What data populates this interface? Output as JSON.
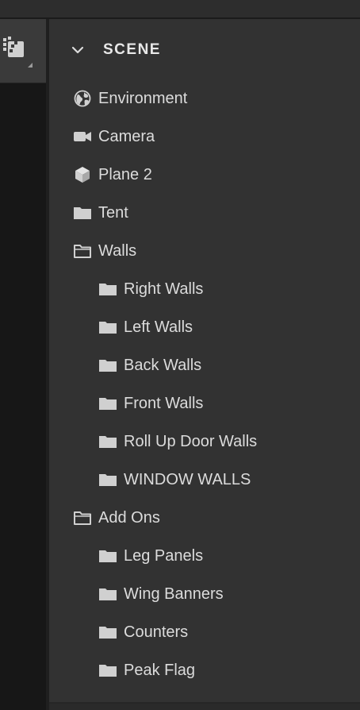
{
  "panel": {
    "header": {
      "title": "SCENE",
      "expand_icon": "chevron-down-icon"
    },
    "items": [
      {
        "label": "Environment",
        "icon": "globe-icon"
      },
      {
        "label": "Camera",
        "icon": "camera-icon"
      },
      {
        "label": "Plane 2",
        "icon": "cube-icon"
      },
      {
        "label": "Tent",
        "icon": "folder-closed-icon"
      },
      {
        "label": "Walls",
        "icon": "folder-open-icon"
      },
      {
        "label": "Right Walls",
        "icon": "folder-closed-icon"
      },
      {
        "label": "Left Walls",
        "icon": "folder-closed-icon"
      },
      {
        "label": "Back Walls",
        "icon": "folder-closed-icon"
      },
      {
        "label": "Front Walls",
        "icon": "folder-closed-icon"
      },
      {
        "label": "Roll Up Door Walls",
        "icon": "folder-closed-icon"
      },
      {
        "label": "WINDOW WALLS",
        "icon": "folder-closed-icon"
      },
      {
        "label": "Add Ons",
        "icon": "folder-open-icon"
      },
      {
        "label": "Leg Panels",
        "icon": "folder-closed-icon"
      },
      {
        "label": "Wing Banners",
        "icon": "folder-closed-icon"
      },
      {
        "label": "Counters",
        "icon": "folder-closed-icon"
      },
      {
        "label": "Peak Flag",
        "icon": "folder-closed-icon"
      }
    ]
  },
  "toolbar": {
    "tool_icon": "select-pixels-tool-icon"
  },
  "colors": {
    "panel_bg": "#323232",
    "text": "#dcdcdc",
    "icon": "#d0d0d0",
    "canvas": "#171717"
  }
}
